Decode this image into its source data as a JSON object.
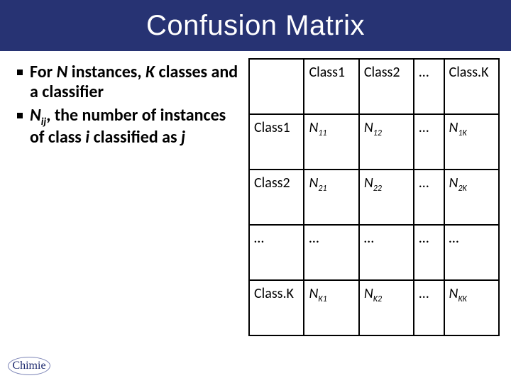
{
  "title": "Confusion Matrix",
  "bullets": {
    "b1_before": "For ",
    "b1_N": "N",
    "b1_mid1": " instances, ",
    "b1_K": "K",
    "b1_after": " classes and a classifier",
    "b2_N": "N",
    "b2_sub": "ij",
    "b2_mid": ", the number of instances of class ",
    "b2_i": "i",
    "b2_mid2": " classified as ",
    "b2_j": "j"
  },
  "table": {
    "h_c1": "Class1",
    "h_c2": "Class2",
    "h_dots": "…",
    "h_ck": "Class.K",
    "r1_h": "Class1",
    "r2_h": "Class2",
    "r3_h": "…",
    "r4_h": "Class.K",
    "n": "N",
    "s11": "11",
    "s12": "12",
    "s1k": "1K",
    "s21": "21",
    "s22": "22",
    "s2k": "2K",
    "sk1": "K1",
    "sk2": "K2",
    "skk": "KK",
    "dots": "…"
  },
  "logo": "Chimie",
  "chart_data": {
    "type": "table",
    "title": "Confusion Matrix",
    "row_labels": [
      "Class1",
      "Class2",
      "…",
      "Class.K"
    ],
    "col_labels": [
      "Class1",
      "Class2",
      "…",
      "Class.K"
    ],
    "cells": [
      [
        "N11",
        "N12",
        "…",
        "N1K"
      ],
      [
        "N21",
        "N22",
        "…",
        "N2K"
      ],
      [
        "…",
        "…",
        "…",
        "…"
      ],
      [
        "NK1",
        "NK2",
        "…",
        "NKK"
      ]
    ]
  }
}
